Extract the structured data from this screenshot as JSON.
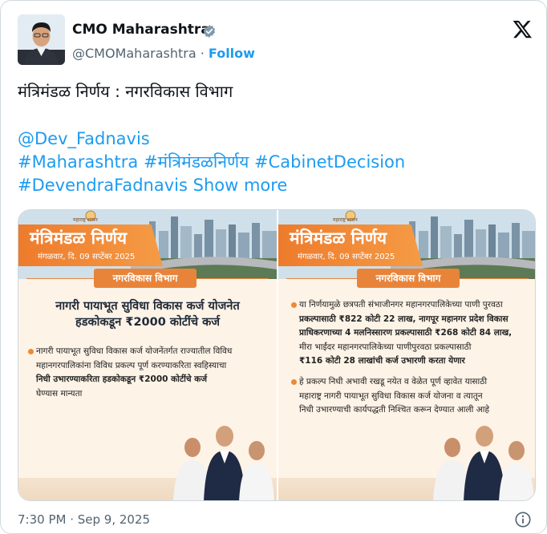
{
  "account": {
    "name": "CMO Maharashtra",
    "handle": "@CMOMaharashtra",
    "separator": "·",
    "follow_label": "Follow",
    "verified_color": "#829aab"
  },
  "post": {
    "title": "मंत्रिमंडळ निर्णय : नगरविकास विभाग",
    "mention": "@Dev_Fadnavis",
    "hashtags_line1": [
      "#Maharashtra",
      "#मंत्रिमंडळनिर्णय",
      "#CabinetDecision"
    ],
    "hashtag_line3": "#DevendraFadnavis",
    "show_more": "Show more"
  },
  "cards": [
    {
      "banner_title": "मंत्रिमंडळ निर्णय",
      "banner_date": "मंगळवार, दि. 09 सप्टेंबर 2025",
      "emblem_text": "महाराष्ट्र शासन",
      "dept": "नगरविकास विभाग",
      "heading_line1": "नागरी पायाभूत सुविधा विकास कर्ज योजनेत",
      "heading_line2": "हडकोकडून ₹2000 कोटींचे कर्ज",
      "bullets": [
        {
          "lines": [
            "नागरी पायाभूत सुविधा विकास कर्ज योजनेंतर्गत राज्यातील विविध",
            "महानगरपालिकांना विविध प्रकल्प पूर्ण करण्याकरिता स्वहिस्याचा",
            "निधी उभारण्याकरिता हडकोकडून ₹2000 कोटींचे कर्ज",
            "घेण्यास मान्यता"
          ]
        }
      ]
    },
    {
      "banner_title": "मंत्रिमंडळ निर्णय",
      "banner_date": "मंगळवार, दि. 09 सप्टेंबर 2025",
      "emblem_text": "महाराष्ट्र शासन",
      "dept": "नगरविकास विभाग",
      "bullets": [
        {
          "lines": [
            "या निर्णयामुळे छत्रपती संभाजीनगर महानगरपालिकेच्या पाणी पुरवठा",
            "प्रकल्पासाठी ₹822 कोटी 22 लाख, नागपूर महानगर प्रदेश विकास",
            "प्राधिकरणाच्या 4 मलनिस्सारण प्रकल्पासाठी ₹268 कोटी 84 लाख,",
            "मीरा भाईंदर महानगरपालिकेच्या पाणीपुरवठा प्रकल्पासाठी",
            "₹116 कोटी 28 लाखांची कर्ज उभारणी करता येणार"
          ]
        },
        {
          "lines": [
            "हे प्रकल्प निधी अभावी रखडू नयेत व वेळेत पूर्ण व्हावेत यासाठी",
            "महाराष्ट्र नागरी पायाभूत सुविधा विकास कर्ज योजना व त्यातून",
            "निधी उभारण्याची कार्यपद्धती निश्चित करून देण्यात आली आहे"
          ]
        }
      ]
    }
  ],
  "footer": {
    "timestamp": "7:30 PM · Sep 9, 2025"
  },
  "colors": {
    "link": "#1d9bf0",
    "accent_orange": "#ee7b2c",
    "muted": "#536471"
  }
}
